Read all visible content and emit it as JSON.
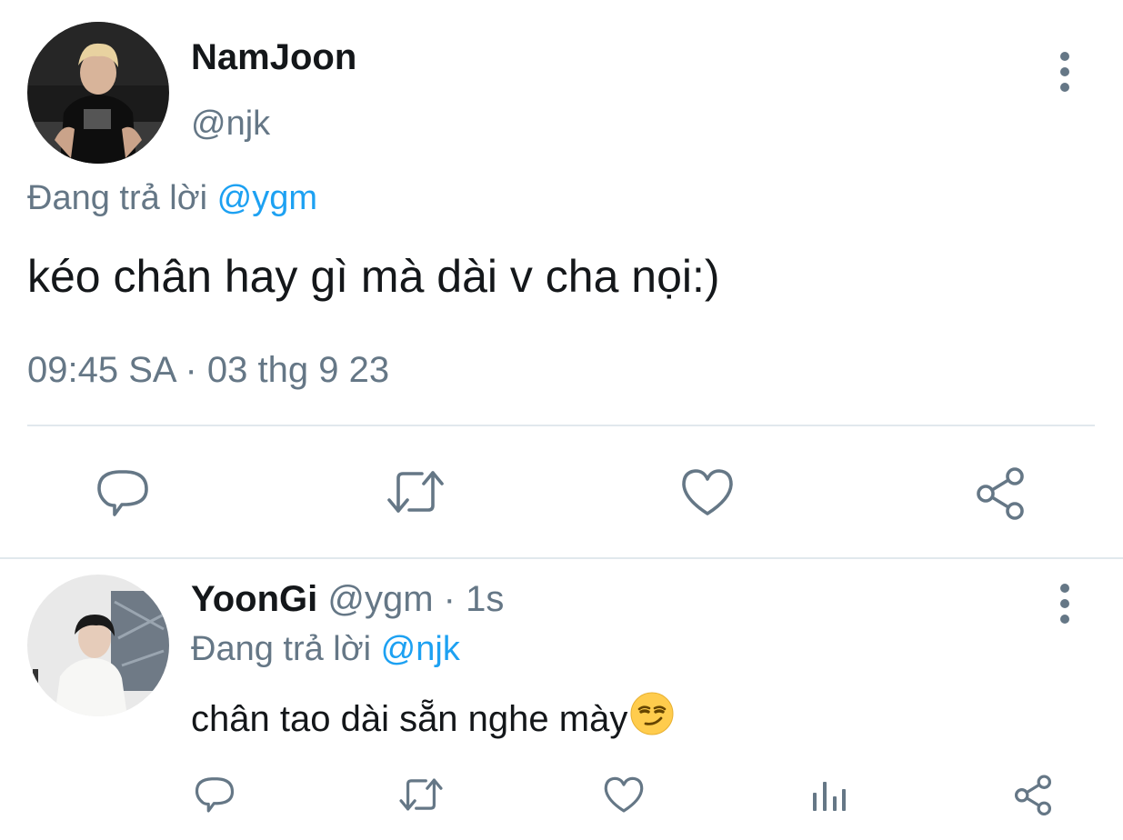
{
  "main_tweet": {
    "author_name": "NamJoon",
    "handle": "@njk",
    "replying_prefix": "Đang trả lời ",
    "replying_to": "@ygm",
    "text": "kéo chân hay gì mà dài v cha nọi:)",
    "timestamp": "09:45 SA · 03 thg 9 23",
    "actions": [
      "reply-icon",
      "retweet-icon",
      "like-icon",
      "share-icon"
    ]
  },
  "reply_tweet": {
    "author_name": "YoonGi",
    "handle_time": "@ygm · 1s",
    "replying_prefix": "Đang trả lời ",
    "replying_to": "@njk",
    "text": "chân tao dài sẵn nghe mày",
    "emoji": "smirking-face-emoji",
    "actions": [
      "reply-icon",
      "retweet-icon",
      "like-icon",
      "analytics-icon",
      "share-icon"
    ]
  },
  "colors": {
    "text": "#14171a",
    "muted": "#657786",
    "link": "#1da1f2",
    "divider": "#e1e8ed"
  }
}
